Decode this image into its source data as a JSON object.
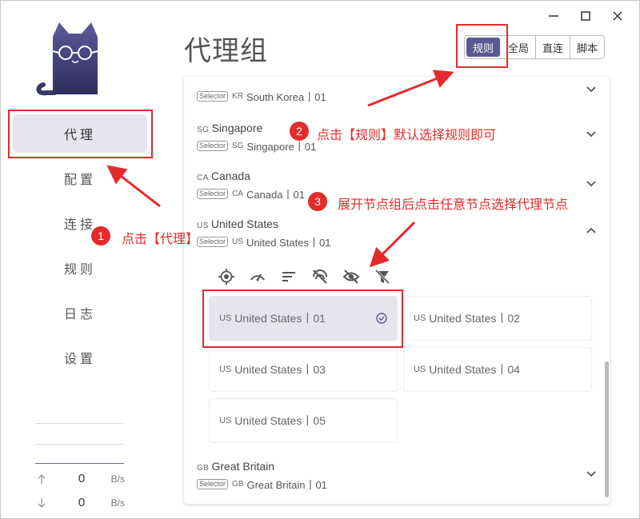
{
  "window": {
    "controls": [
      {
        "name": "minimize-button",
        "icon": "minimize-icon"
      },
      {
        "name": "maximize-button",
        "icon": "maximize-icon"
      },
      {
        "name": "close-button",
        "icon": "close-icon"
      }
    ]
  },
  "sidebar": {
    "items": [
      {
        "label": "代理",
        "active": true
      },
      {
        "label": "配置",
        "active": false
      },
      {
        "label": "连接",
        "active": false
      },
      {
        "label": "规则",
        "active": false
      },
      {
        "label": "日志",
        "active": false
      },
      {
        "label": "设置",
        "active": false
      }
    ],
    "traffic": {
      "up": {
        "value": "0",
        "unit": "B/s"
      },
      "down": {
        "value": "0",
        "unit": "B/s"
      }
    }
  },
  "header": {
    "title": "代理组",
    "modes": [
      {
        "label": "规则",
        "active": true
      },
      {
        "label": "全局",
        "active": false
      },
      {
        "label": "直连",
        "active": false
      },
      {
        "label": "脚本",
        "active": false
      }
    ]
  },
  "groups": [
    {
      "cc": "",
      "name": "",
      "badge": "Selector",
      "sub_cc": "KR",
      "sub": "South Korea丨01",
      "expanded": false
    },
    {
      "cc": "SG",
      "name": "Singapore",
      "badge": "Selector",
      "sub_cc": "SG",
      "sub": "Singapore丨01",
      "expanded": false
    },
    {
      "cc": "CA",
      "name": "Canada",
      "badge": "Selector",
      "sub_cc": "CA",
      "sub": "Canada丨01",
      "expanded": false
    },
    {
      "cc": "US",
      "name": "United States",
      "badge": "Selector",
      "sub_cc": "US",
      "sub": "United States丨01",
      "expanded": true
    },
    {
      "cc": "GB",
      "name": "Great Britain",
      "badge": "Selector",
      "sub_cc": "GB",
      "sub": "Great Britain丨01",
      "expanded": false
    }
  ],
  "toolbar_icons": [
    "locate-icon",
    "speed-test-icon",
    "sort-icon",
    "hide-unavailable-icon",
    "hide-icon",
    "filter-off-icon"
  ],
  "nodes": [
    {
      "cc": "US",
      "label": "United States丨01",
      "selected": true
    },
    {
      "cc": "US",
      "label": "United States丨02",
      "selected": false
    },
    {
      "cc": "US",
      "label": "United States丨03",
      "selected": false
    },
    {
      "cc": "US",
      "label": "United States丨04",
      "selected": false
    },
    {
      "cc": "US",
      "label": "United States丨05",
      "selected": false
    }
  ],
  "annotations": [
    {
      "num": "1",
      "text": "点击【代理】"
    },
    {
      "num": "2",
      "text": "点击【规则】默认选择规则即可"
    },
    {
      "num": "3",
      "text": "展开节点组后点击任意节点选择代理节点"
    }
  ],
  "colors": {
    "accent": "#5a5994",
    "active_bg": "#e6e5ef",
    "annotation_red": "#e32b2b"
  }
}
